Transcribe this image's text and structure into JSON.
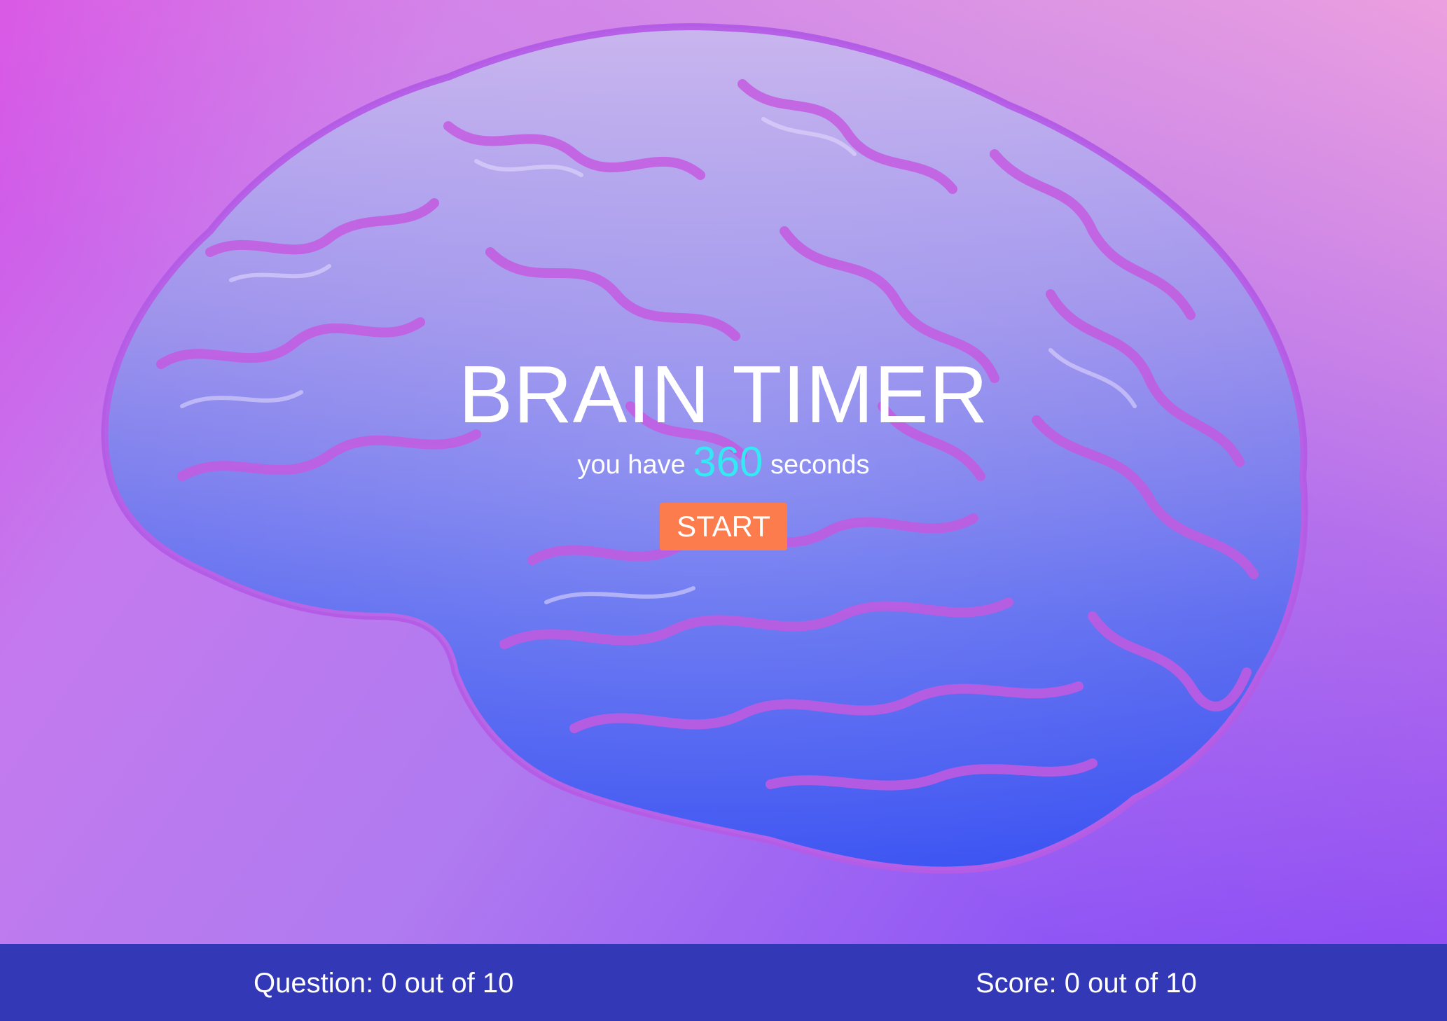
{
  "game": {
    "title": "BRAIN TIMER",
    "timer_prefix": "you have",
    "timer_seconds": "360",
    "timer_suffix": "seconds",
    "start_label": "START"
  },
  "footer": {
    "question_text": "Question: 0 out of 10",
    "score_text": "Score: 0 out of 10"
  },
  "colors": {
    "accent_timer": "#34e8f4",
    "start_button": "#fc7c4e",
    "footer_bar": "#3338b6"
  },
  "background_icon": "brain-illustration"
}
